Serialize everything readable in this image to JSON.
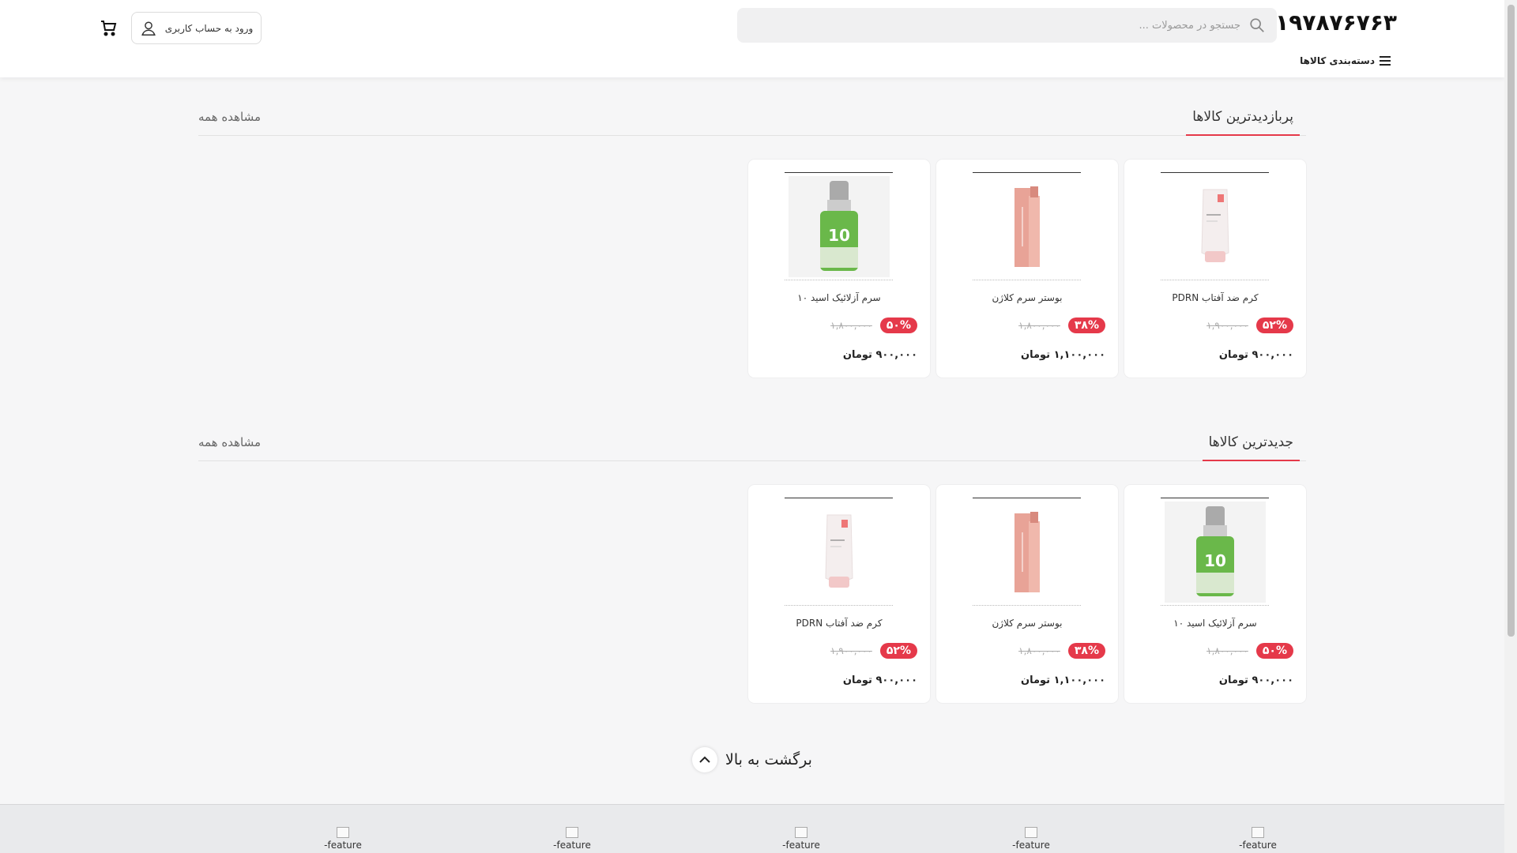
{
  "header": {
    "logo": "۹۱۹۷۸۷۶۷۶۳",
    "search_placeholder": "جستجو در محصولات ...",
    "login_label": "ورود به حساب کاربری",
    "categories_label": "دسته‌بندی کالاها"
  },
  "sections": [
    {
      "title": "پربازدیدترین کالاها",
      "view_all": "مشاهده همه",
      "products": [
        {
          "name": "کرم ضد آفتاب PDRN",
          "discount": "۵۲%",
          "old_price": "۱,۹۰۰,۰۰۰",
          "price": "۹۰۰,۰۰۰ تومان",
          "image": "tube"
        },
        {
          "name": "بوستر سرم کلاژن",
          "discount": "۳۸%",
          "old_price": "۱,۸۰۰,۰۰۰",
          "price": "۱,۱۰۰,۰۰۰ تومان",
          "image": "pink-bottle"
        },
        {
          "name": "سرم آزلائیک اسید ۱۰",
          "discount": "۵۰%",
          "old_price": "۱,۸۰۰,۰۰۰",
          "price": "۹۰۰,۰۰۰ تومان",
          "image": "green-dropper"
        }
      ]
    },
    {
      "title": "جدیدترین کالاها",
      "view_all": "مشاهده همه",
      "products": [
        {
          "name": "سرم آزلائیک اسید ۱۰",
          "discount": "۵۰%",
          "old_price": "۱,۸۰۰,۰۰۰",
          "price": "۹۰۰,۰۰۰ تومان",
          "image": "green-dropper"
        },
        {
          "name": "بوستر سرم کلاژن",
          "discount": "۳۸%",
          "old_price": "۱,۸۰۰,۰۰۰",
          "price": "۱,۱۰۰,۰۰۰ تومان",
          "image": "pink-bottle"
        },
        {
          "name": "کرم ضد آفتاب PDRN",
          "discount": "۵۲%",
          "old_price": "۱,۹۰۰,۰۰۰",
          "price": "۹۰۰,۰۰۰ تومان",
          "image": "tube"
        }
      ]
    }
  ],
  "back_to_top": "برگشت به بالا",
  "footer": {
    "features": [
      "feature-",
      "feature-",
      "feature-",
      "feature-",
      "feature-"
    ]
  },
  "colors": {
    "accent": "#e5394a",
    "background": "#f6f6f7"
  }
}
